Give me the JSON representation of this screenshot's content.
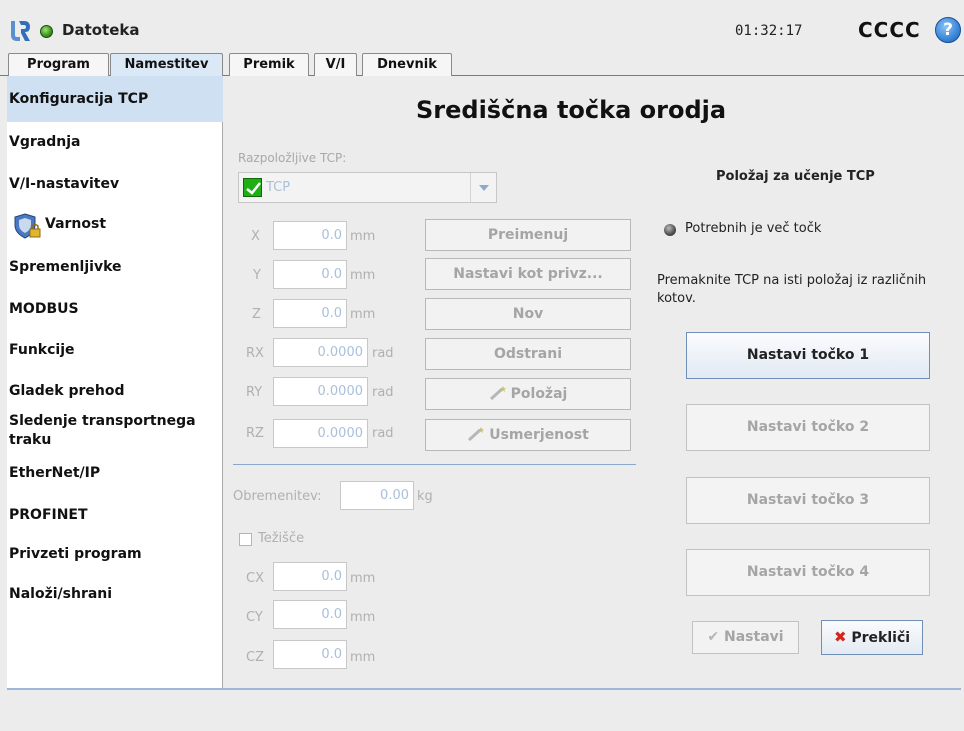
{
  "header": {
    "file_label": "Datoteka",
    "clock": "01:32:17",
    "robot_name": "CCCC",
    "help_symbol": "?"
  },
  "tabs": [
    {
      "label": "Program"
    },
    {
      "label": "Namestitev"
    },
    {
      "label": "Premik"
    },
    {
      "label": "V/I"
    },
    {
      "label": "Dnevnik"
    }
  ],
  "sidebar": {
    "items": [
      {
        "label": "Konfiguracija TCP"
      },
      {
        "label": "Vgradnja"
      },
      {
        "label": "V/I-nastavitev"
      },
      {
        "label": "Varnost"
      },
      {
        "label": "Spremenljivke"
      },
      {
        "label": "MODBUS"
      },
      {
        "label": "Funkcije"
      },
      {
        "label": "Gladek prehod"
      },
      {
        "label": "Sledenje transportnega traku"
      },
      {
        "label": "EtherNet/IP"
      },
      {
        "label": "PROFINET"
      },
      {
        "label": "Privzeti program"
      },
      {
        "label": "Naloži/shrani"
      }
    ]
  },
  "main": {
    "title": "Središčna točka orodja",
    "available_label": "Razpoložljive TCP:",
    "selected_tcp": "TCP",
    "coords": [
      {
        "axis": "X",
        "value": "0.0",
        "unit": "mm"
      },
      {
        "axis": "Y",
        "value": "0.0",
        "unit": "mm"
      },
      {
        "axis": "Z",
        "value": "0.0",
        "unit": "mm"
      },
      {
        "axis": "RX",
        "value": "0.0000",
        "unit": "rad"
      },
      {
        "axis": "RY",
        "value": "0.0000",
        "unit": "rad"
      },
      {
        "axis": "RZ",
        "value": "0.0000",
        "unit": "rad"
      }
    ],
    "buttons": {
      "rename": "Preimenuj",
      "set_default": "Nastavi kot privz...",
      "new": "Nov",
      "remove": "Odstrani",
      "position": "Položaj",
      "orientation": "Usmerjenost"
    },
    "payload_label": "Obremenitev:",
    "payload_value": "0.00",
    "payload_unit": "kg",
    "cog_label": "Težišče",
    "cog": [
      {
        "axis": "CX",
        "value": "0.0",
        "unit": "mm"
      },
      {
        "axis": "CY",
        "value": "0.0",
        "unit": "mm"
      },
      {
        "axis": "CZ",
        "value": "0.0",
        "unit": "mm"
      }
    ]
  },
  "teach": {
    "title": "Položaj za učenje TCP",
    "status": "Potrebnih je več točk",
    "instruction": "Premaknite TCP na isti položaj iz različnih kotov.",
    "points": [
      {
        "label": "Nastavi točko 1"
      },
      {
        "label": "Nastavi točko 2"
      },
      {
        "label": "Nastavi točko 3"
      },
      {
        "label": "Nastavi točko 4"
      }
    ],
    "set_label": "Nastavi",
    "cancel_label": "Prekliči"
  },
  "colors": {
    "accent": "#cfe0f3",
    "ok_green": "#1fae14",
    "cancel_red": "#d5261e"
  }
}
